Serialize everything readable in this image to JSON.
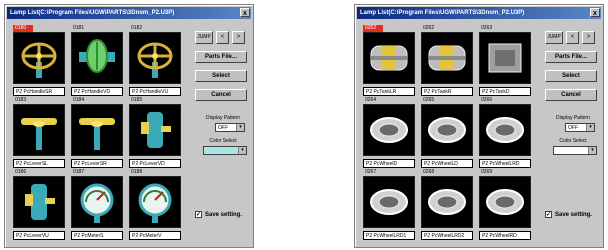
{
  "left_window": {
    "title": "Lamp List(C:\\Program Files\\UGW\\PARTS\\3Dnom_P2.U3P)",
    "selected_id": "0180",
    "items": [
      {
        "id": "0180",
        "name": "P2 PcHandleSR",
        "kind": "handle"
      },
      {
        "id": "0181",
        "name": "P2 PcHandleVD",
        "kind": "valve-green"
      },
      {
        "id": "0182",
        "name": "P2 PcHandleVU",
        "kind": "handle"
      },
      {
        "id": "0183",
        "name": "P2 PcLeverSL",
        "kind": "lever"
      },
      {
        "id": "0184",
        "name": "P2 PcLeverSR",
        "kind": "lever"
      },
      {
        "id": "0185",
        "name": "P2 PcLeverVD",
        "kind": "lever-v"
      },
      {
        "id": "0186",
        "name": "P2 PcLeverVU",
        "kind": "lever-v"
      },
      {
        "id": "0187",
        "name": "P2 PcMeterS",
        "kind": "meter"
      },
      {
        "id": "0188",
        "name": "P2 PcMeterV",
        "kind": "meter"
      }
    ],
    "display_pattern_value": "OFF",
    "color_select_color": "#a8e6e6",
    "save_checked": true
  },
  "right_window": {
    "title": "Lamp List(C:\\Program Files\\UGW\\PARTS\\3Dnom_P2.U3P)",
    "selected_id": "0262",
    "items": [
      {
        "id": "0262",
        "name": "P2 PcTankLR",
        "kind": "tank-yellow"
      },
      {
        "id": "0262",
        "name": "P2 PcTankR",
        "kind": "tank-yellow"
      },
      {
        "id": "0263",
        "name": "P2 PcTankD",
        "kind": "tank-gray"
      },
      {
        "id": "0264",
        "name": "P2 PcWheelD",
        "kind": "wheel"
      },
      {
        "id": "0265",
        "name": "P2 PcWheelLD",
        "kind": "wheel"
      },
      {
        "id": "0266",
        "name": "P2 PcWheelLRD",
        "kind": "wheel"
      },
      {
        "id": "0267",
        "name": "P2 PcWheelLRD1",
        "kind": "wheel"
      },
      {
        "id": "0268",
        "name": "P2 PcWheelLRD2",
        "kind": "wheel"
      },
      {
        "id": "0269",
        "name": "P2 PcWheelRD",
        "kind": "wheel"
      }
    ],
    "display_pattern_value": "OFF",
    "color_select_color": "#ffffff",
    "save_checked": true
  },
  "controls": {
    "jump_label": "JUMP",
    "prev_label": "<",
    "next_label": ">",
    "parts_file_label": "Parts File...",
    "select_label": "Select",
    "cancel_label": "Cancel",
    "display_pattern_label": "Display Pattern",
    "color_select_label": "Color Select",
    "save_setting_label": "Save setting.",
    "close_label": "x",
    "dropdown_arrow": "▾",
    "checkmark": "✓"
  }
}
